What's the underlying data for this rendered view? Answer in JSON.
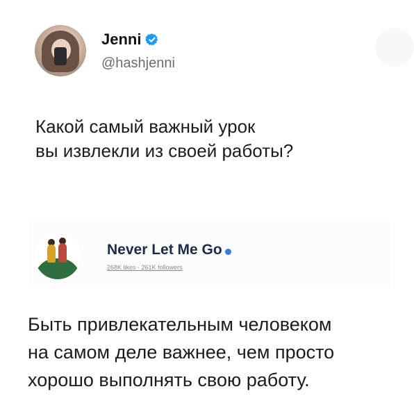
{
  "tweet": {
    "name": "Jenni",
    "handle": "@hashjenni",
    "question_lines": [
      "Какой самый важный урок",
      "вы извлекли из своей работы?"
    ]
  },
  "reply_card": {
    "title": "Never Let Me Go",
    "stats": "268K likes · 261K followers"
  },
  "answer_lines": [
    "Быть привлекательным человеком",
    "на самом деле важнее, чем просто",
    "хорошо выполнять свою работу."
  ],
  "colors": {
    "verified_blue": "#1d9bf0",
    "card_title": "#1f2a44"
  },
  "icons": {
    "verified": "verified-badge-icon"
  }
}
